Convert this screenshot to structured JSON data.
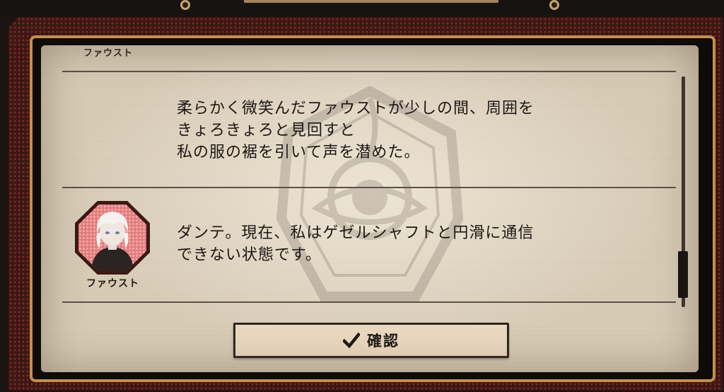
{
  "dialog": {
    "log_entries": [
      {
        "speaker": "ファウスト",
        "lines": []
      },
      {
        "speaker": "",
        "lines": [
          "柔らかく微笑んだファウストが少しの間、周囲を",
          "きょろきょろと見回すと",
          "私の服の裾を引いて声を潜めた。"
        ]
      },
      {
        "speaker": "ファウスト",
        "avatar_icon": "character-portrait",
        "lines": [
          "ダンテ。現在、私はゲゼルシャフトと円滑に通信",
          "できない状態です。"
        ]
      }
    ],
    "scroll_position": 0.85,
    "confirm_label": "確認",
    "confirm_icon": "check-icon"
  },
  "colors": {
    "panel": "#d9cdb8",
    "gold_frame": "#c58e4f",
    "red_frame": "#3a1714",
    "text": "#1c1814",
    "avatar_bg": "#e27c7c"
  }
}
